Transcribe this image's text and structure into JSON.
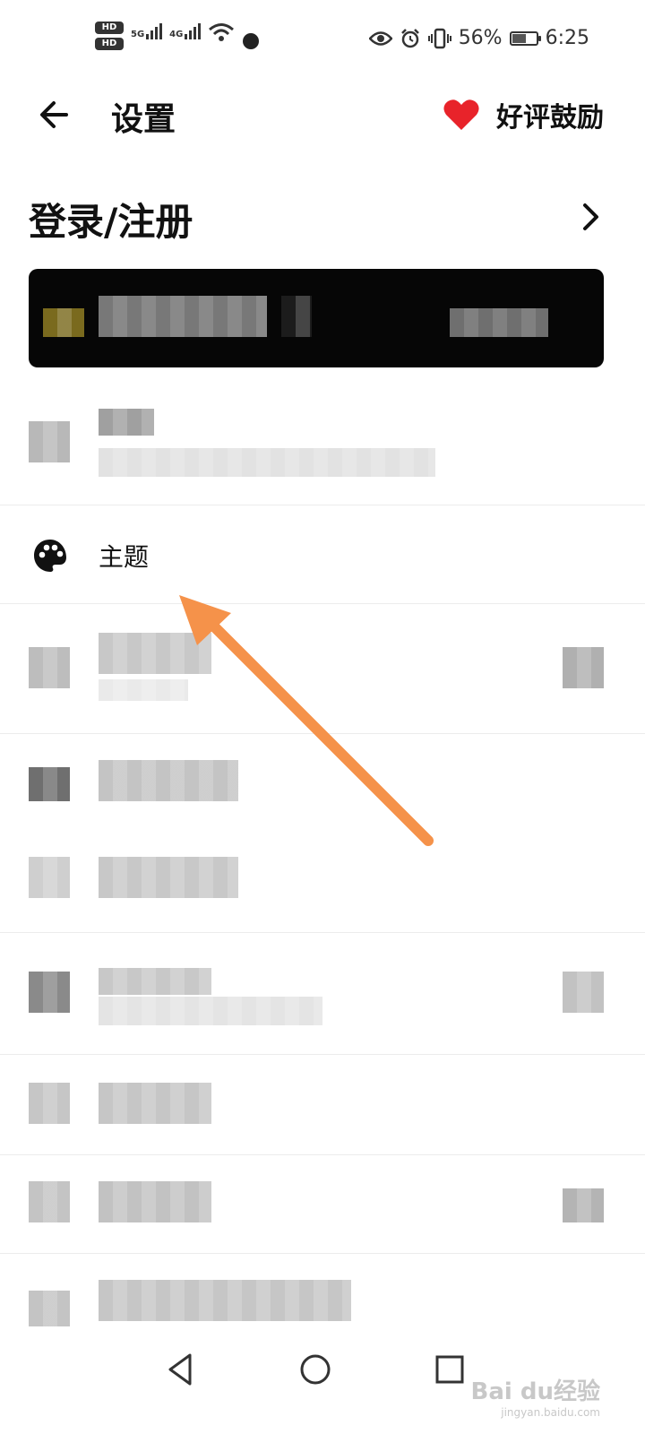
{
  "status_bar": {
    "sim1": "HD",
    "sim2": "HD",
    "net1": "5G",
    "net2": "4G",
    "battery_percent": "56%",
    "battery_level": 0.56,
    "time": "6:25",
    "icons": [
      "eye-icon",
      "alarm-icon",
      "vibrate-icon",
      "battery-icon",
      "wifi-icon"
    ]
  },
  "header": {
    "title": "设置",
    "rate_label": "好评鼓励",
    "heart_color": "#e8232a"
  },
  "login": {
    "label": "登录/注册"
  },
  "list": {
    "theme_label": "主题"
  },
  "colors": {
    "arrow": "#f5924a",
    "banner": "#060606"
  },
  "watermark": {
    "brand": "Bai du经验",
    "site": "jingyan.baidu.com"
  }
}
